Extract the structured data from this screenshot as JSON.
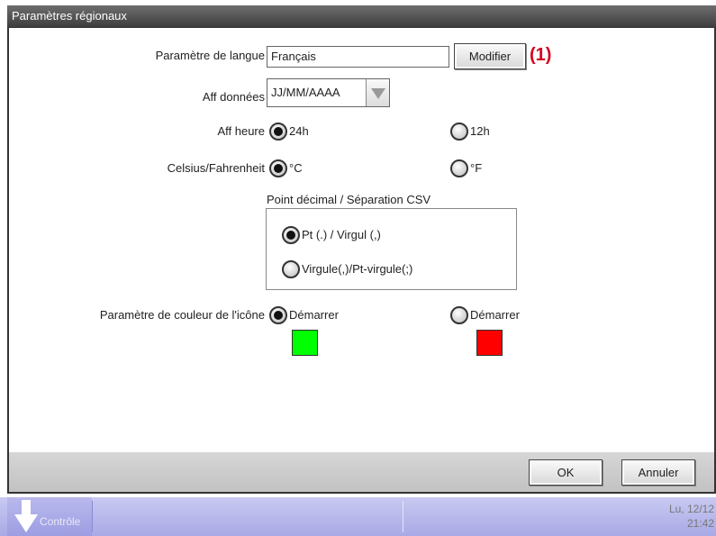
{
  "window": {
    "title": "Paramètres régionaux"
  },
  "language": {
    "label": "Paramètre de langue",
    "value": "Français",
    "button": "Modifier",
    "annotation": "(1)"
  },
  "date_display": {
    "label": "Aff données",
    "value": "JJ/MM/AAAA"
  },
  "time_display": {
    "label": "Aff heure",
    "options": [
      "24h",
      "12h"
    ],
    "selected": "24h"
  },
  "temperature": {
    "label": "Celsius/Fahrenheit",
    "options": [
      "°C",
      "°F"
    ],
    "selected": "°C"
  },
  "decimal": {
    "label": "Point décimal / Séparation CSV",
    "options": [
      "Pt (.) / Virgul (,)",
      "Virgule(,)/Pt-virgule(;)"
    ],
    "selected": "Pt (.) / Virgul (,)"
  },
  "icon_color": {
    "label": "Paramètre de couleur de l'icône",
    "options": [
      {
        "text": "Démarrer",
        "color": "#00ff00"
      },
      {
        "text": "Démarrer",
        "color": "#ff0000"
      }
    ],
    "selected_index": 0
  },
  "footer": {
    "ok": "OK",
    "cancel": "Annuler"
  },
  "taskbar": {
    "left_label": "Contrôle",
    "date": "Lu, 12/12",
    "time": "21:42"
  }
}
